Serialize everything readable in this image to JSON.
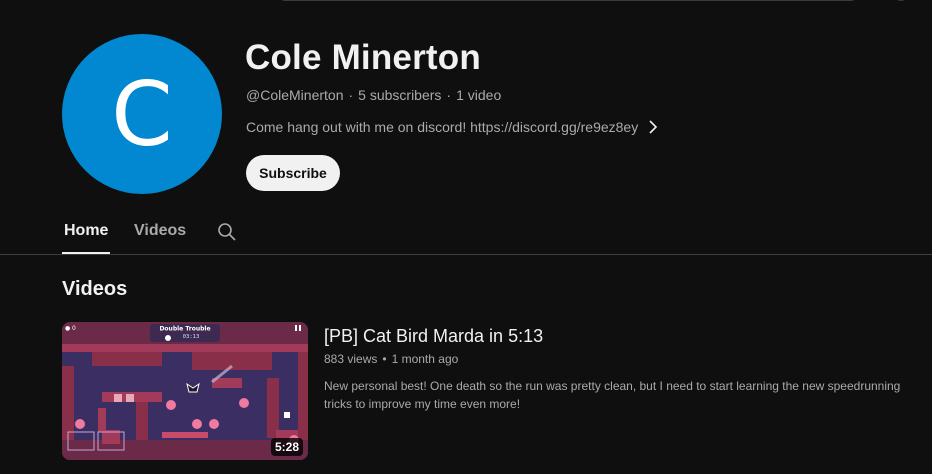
{
  "colors": {
    "background": "#0f0f0f",
    "avatar_bg": "#0288d1",
    "text_primary": "#f1f1f1",
    "text_secondary": "#aaaaaa",
    "subscribe_bg": "#f1f1f1"
  },
  "channel": {
    "avatar_letter": "C",
    "name": "Cole Minerton",
    "handle": "@ColeMinerton",
    "meta_sep": "·",
    "subscribers": "5 subscribers",
    "video_count": "1 video",
    "description": "Come hang out with me on discord! https://discord.gg/re9ez8ey",
    "description_more_icon": "chevron-right-icon",
    "subscribe_label": "Subscribe"
  },
  "tabs": [
    {
      "label": "Home",
      "active": true
    },
    {
      "label": "Videos",
      "active": false
    }
  ],
  "search_icon": "search-icon",
  "section": {
    "title": "Videos"
  },
  "videos": [
    {
      "title": "[PB] Cat Bird Marda in 5:13",
      "views": "883 views",
      "meta_sep": "•",
      "age": "1 month ago",
      "description": "New personal best! One death so the run was pretty clean, but I need to start learning the new speedrunning tricks to improve my time even more!",
      "duration": "5:28",
      "thumbnail": {
        "level_name": "Double Trouble",
        "timer": "03:13",
        "counter": "0"
      }
    }
  ]
}
